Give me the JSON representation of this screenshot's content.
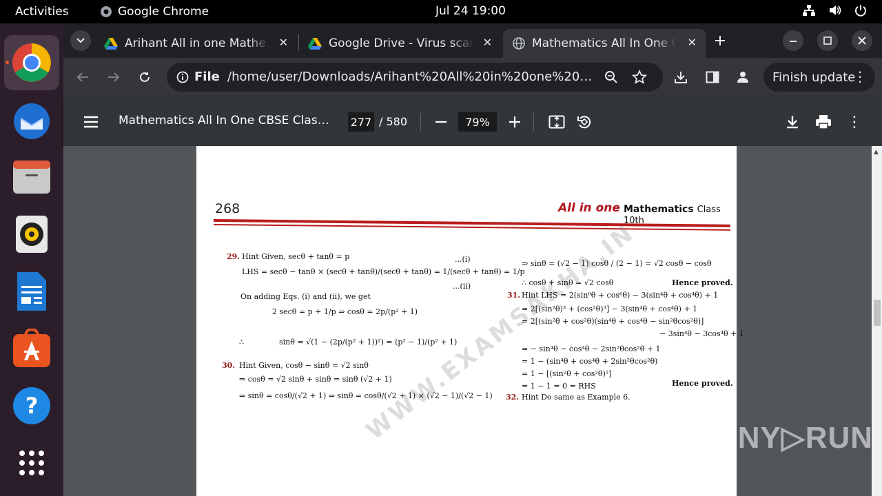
{
  "system_bar": {
    "activities": "Activities",
    "app_name": "Google Chrome",
    "clock": "Jul 24  19:00"
  },
  "tabs": [
    {
      "title": "Arihant All in one Mathe",
      "icon": "google-drive-icon"
    },
    {
      "title": "Google Drive - Virus scar",
      "icon": "google-drive-icon"
    },
    {
      "title": "Mathematics All In One C",
      "icon": "globe-icon"
    }
  ],
  "toolbar": {
    "scheme_label": "File",
    "url": "/home/user/Downloads/Arihant%20All%20in%20one%20Mathe...",
    "finish_update": "Finish update"
  },
  "pdf": {
    "title": "Mathematics All In One CBSE Class 1...",
    "page_current": "277",
    "page_total": "/ 580",
    "zoom": "79%"
  },
  "page_content": {
    "page_number": "268",
    "brand": "All in one",
    "subject": "Mathematics",
    "class_label": "Class 10th",
    "watermark": "WWW.EXAMSAKHA.IN",
    "q29_num": "29.",
    "q29_line1": "Hint Given, secθ + tanθ = p",
    "q29_tag1": "...(i)",
    "q29_line2": "LHS = secθ − tanθ × (secθ + tanθ)/(secθ + tanθ) = 1/(secθ + tanθ) = 1/p",
    "q29_tag2": "...(ii)",
    "q29_line3": "On adding Eqs. (i) and (ii), we get",
    "q29_line4": "2 secθ = p + 1/p ⇒ cosθ = 2p/(p² + 1)",
    "q29_therefore": "∴",
    "q29_line5": "sinθ = √(1 − (2p/(p² + 1))²) = (p² − 1)/(p² + 1)",
    "q30_num": "30.",
    "q30_line1": "Hint Given,  cosθ − sinθ = √2 sinθ",
    "q30_line2": "⇒       cosθ = √2 sinθ + sinθ = sinθ (√2 + 1)",
    "q30_line3": "⇒       sinθ = cosθ/(√2 + 1)  ⇒ sinθ = cosθ/(√2 + 1) × (√2 − 1)/(√2 − 1)",
    "r_line1": "⇒        sinθ = (√2 − 1) cosθ / (2 − 1) = √2 cosθ − cosθ",
    "r_line2": "∴ cosθ + sinθ = √2 cosθ",
    "r_hence1": "Hence proved.",
    "q31_num": "31.",
    "q31_line1": "Hint LHS = 2(sin⁶θ + cos⁶θ) − 3(sin⁴θ + cos⁴θ) + 1",
    "q31_line2": "= 2[(sin²θ)³ + (cos²θ)³] − 3(sin⁴θ + cos⁴θ) + 1",
    "q31_line3": "= 2[(sin²θ + cos²θ)(sin⁴θ + cos⁴θ − sin²θcos²θ)]",
    "q31_line4": "− 3sin⁴θ − 3cos⁴θ + 1",
    "q31_line5": "= − sin⁴θ − cos⁴θ − 2sin²θcos²θ + 1",
    "q31_line6": "= 1 − (sin⁴θ + cos⁴θ + 2sin²θcos²θ)",
    "q31_line7": "= 1 − [(sin²θ + cos²θ)²]",
    "q31_line8": "= 1 − 1 = 0 = RHS",
    "r_hence2": "Hence proved.",
    "q32_num": "32.",
    "q32_line1": "Hint Do same as Example 6."
  },
  "overlay": {
    "anyrun": "ANY▷RUN"
  },
  "colors": {
    "chrome_bg": "#35363a",
    "tabstrip_bg": "#202124",
    "pdf_toolbar_bg": "#323639",
    "viewer_bg": "#525659",
    "dock_bg": "#2b1e2a",
    "brand_red": "#b0151a"
  }
}
